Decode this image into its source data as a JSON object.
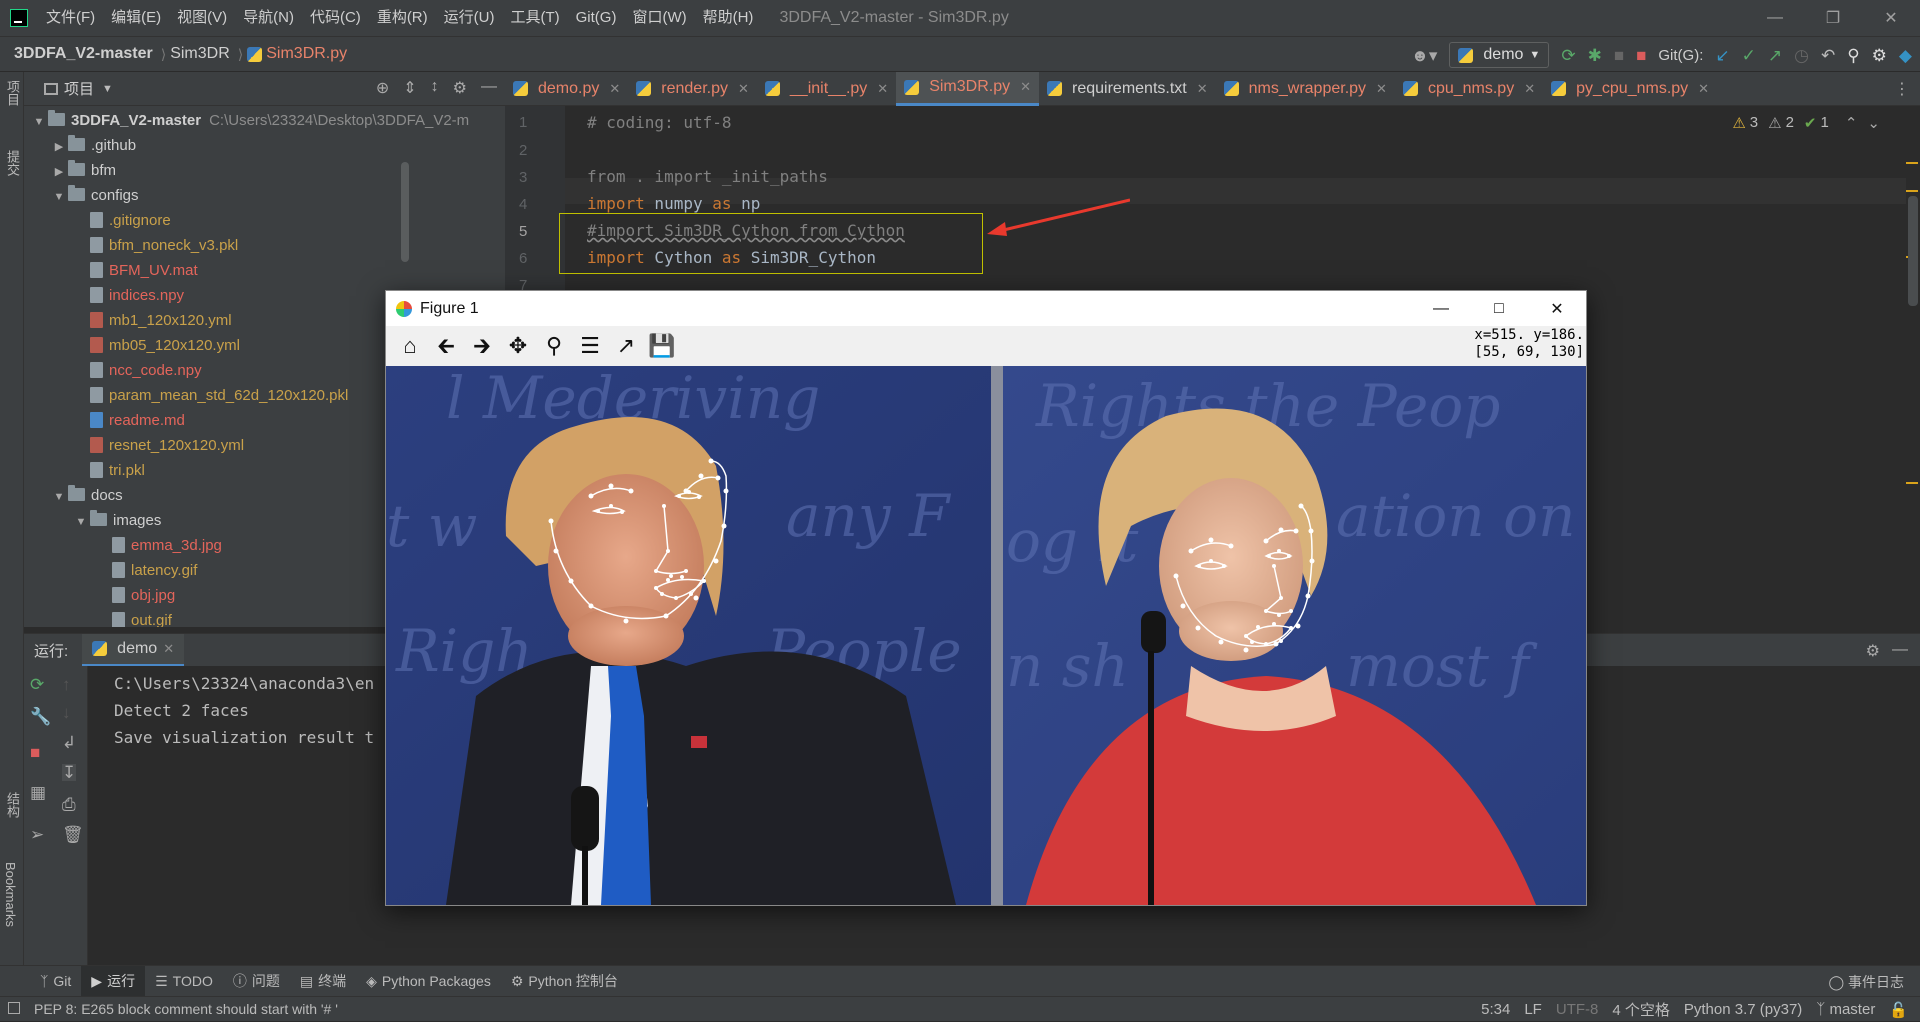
{
  "menu": [
    "文件(F)",
    "编辑(E)",
    "视图(V)",
    "导航(N)",
    "代码(C)",
    "重构(R)",
    "运行(U)",
    "工具(T)",
    "Git(G)",
    "窗口(W)",
    "帮助(H)"
  ],
  "window_title": "3DDFA_V2-master - Sim3DR.py",
  "breadcrumb": [
    "3DDFA_V2-master",
    "Sim3DR",
    "Sim3DR.py"
  ],
  "run_config": "demo",
  "git_label": "Git(G):",
  "left_strip": {
    "project": "项目",
    "commit": "提交",
    "structure": "结构",
    "bookmarks": "Bookmarks"
  },
  "project_panel": {
    "title": "项目",
    "root": {
      "name": "3DDFA_V2-master",
      "path": "C:\\Users\\23324\\Desktop\\3DDFA_V2-m"
    },
    "items": [
      {
        "name": ".github",
        "kind": "folder",
        "state": "collapsed",
        "depth": 1
      },
      {
        "name": "bfm",
        "kind": "folder",
        "state": "collapsed",
        "depth": 1
      },
      {
        "name": "configs",
        "kind": "folder",
        "state": "expanded",
        "depth": 1
      },
      {
        "name": ".gitignore",
        "kind": "file",
        "color": "yellow",
        "depth": 2
      },
      {
        "name": "bfm_noneck_v3.pkl",
        "kind": "file",
        "color": "yellow",
        "depth": 2
      },
      {
        "name": "BFM_UV.mat",
        "kind": "file",
        "color": "red",
        "depth": 2
      },
      {
        "name": "indices.npy",
        "kind": "file",
        "color": "red",
        "depth": 2
      },
      {
        "name": "mb1_120x120.yml",
        "kind": "yml",
        "color": "yellow",
        "depth": 2
      },
      {
        "name": "mb05_120x120.yml",
        "kind": "yml",
        "color": "yellow",
        "depth": 2
      },
      {
        "name": "ncc_code.npy",
        "kind": "file",
        "color": "red",
        "depth": 2
      },
      {
        "name": "param_mean_std_62d_120x120.pkl",
        "kind": "file",
        "color": "yellow",
        "depth": 2
      },
      {
        "name": "readme.md",
        "kind": "md",
        "color": "red",
        "depth": 2
      },
      {
        "name": "resnet_120x120.yml",
        "kind": "yml",
        "color": "yellow",
        "depth": 2
      },
      {
        "name": "tri.pkl",
        "kind": "file",
        "color": "yellow",
        "depth": 2
      },
      {
        "name": "docs",
        "kind": "folder",
        "state": "expanded",
        "depth": 1
      },
      {
        "name": "images",
        "kind": "folder",
        "state": "expanded",
        "depth": 2
      },
      {
        "name": "emma_3d.jpg",
        "kind": "file",
        "color": "red",
        "depth": 3
      },
      {
        "name": "latency.gif",
        "kind": "file",
        "color": "yellow",
        "depth": 3
      },
      {
        "name": "obj.jpg",
        "kind": "file",
        "color": "red",
        "depth": 3
      },
      {
        "name": "out.gif",
        "kind": "file",
        "color": "yellow",
        "depth": 3
      }
    ]
  },
  "editor_tabs": [
    {
      "label": "demo.py",
      "kind": "py",
      "active": false
    },
    {
      "label": "render.py",
      "kind": "py",
      "active": false
    },
    {
      "label": "__init__.py",
      "kind": "py",
      "active": false
    },
    {
      "label": "Sim3DR.py",
      "kind": "py",
      "active": true
    },
    {
      "label": "requirements.txt",
      "kind": "txt",
      "active": false
    },
    {
      "label": "nms_wrapper.py",
      "kind": "py",
      "active": false
    },
    {
      "label": "cpu_nms.py",
      "kind": "py",
      "active": false
    },
    {
      "label": "py_cpu_nms.py",
      "kind": "py",
      "active": false
    }
  ],
  "editor": {
    "line_numbers": [
      "1",
      "2",
      "3",
      "4",
      "5",
      "6",
      "7"
    ],
    "current_line": "5",
    "lines": {
      "l1": "# coding: utf-8",
      "l3_kw": "from",
      "l3_rest": " . import _init_paths",
      "l4_kw": "import",
      "l4_mid": " numpy ",
      "l4_as": "as",
      "l4_end": " np",
      "l5": "#import Sim3DR_Cython from Cython",
      "l6_kw": "import",
      "l6_mid": " Cython ",
      "l6_as": "as",
      "l6_end": " Sim3DR_Cython"
    },
    "inspections": {
      "warnings": "3",
      "weak_warnings": "2",
      "ok": "1"
    }
  },
  "run_panel": {
    "label": "运行:",
    "tab": "demo",
    "console": [
      "C:\\Users\\23324\\anaconda3\\en",
      "Detect 2 faces",
      "Save visualization result t"
    ]
  },
  "bottom_tools": [
    {
      "label": "Git",
      "icon": "git-icon"
    },
    {
      "label": "运行",
      "icon": "run-icon",
      "active": true
    },
    {
      "label": "TODO",
      "icon": "todo-icon"
    },
    {
      "label": "问题",
      "icon": "problems-icon"
    },
    {
      "label": "终端",
      "icon": "terminal-icon"
    },
    {
      "label": "Python Packages",
      "icon": "packages-icon"
    },
    {
      "label": "Python 控制台",
      "icon": "python-console-icon"
    }
  ],
  "event_log": "事件日志",
  "status": {
    "message": "PEP 8: E265 block comment should start with '# '",
    "position": "5:34",
    "line_sep": "LF",
    "encoding": "UTF-8",
    "indent": "4 个空格",
    "interpreter": "Python 3.7 (py37)",
    "branch": "master"
  },
  "figure": {
    "title": "Figure 1",
    "coord_line1": "x=515. y=186.",
    "coord_line2": "[55, 69, 130]",
    "toolbar": [
      "home-icon",
      "back-icon",
      "forward-icon",
      "pan-icon",
      "zoom-icon",
      "subplots-icon",
      "customize-icon",
      "save-icon"
    ]
  },
  "colors": {
    "accent": "#4a88c7",
    "keyword": "#cc7832",
    "comment": "#808080",
    "error_red": "#e4655b",
    "file_yellow": "#c9a14a"
  }
}
